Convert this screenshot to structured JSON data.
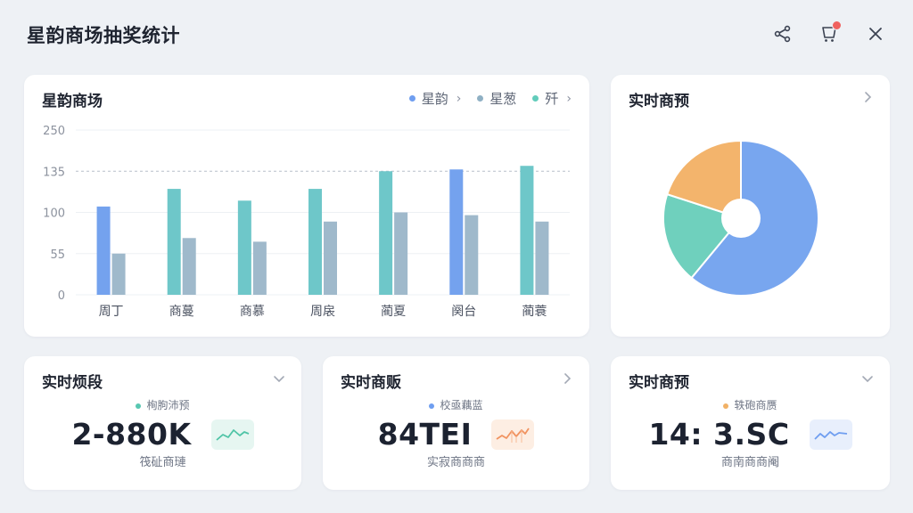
{
  "app": {
    "title": "星韵商场抽奖统计"
  },
  "bar_card": {
    "title": "星韵商场",
    "legend": [
      {
        "label": "星韵",
        "color": "#6f9ef0",
        "arrow": true
      },
      {
        "label": "星葱",
        "color": "#8fb0c4",
        "arrow": false
      },
      {
        "label": "歼",
        "color": "#62ccbb",
        "arrow": true
      }
    ]
  },
  "pie_card": {
    "title": "实时商预"
  },
  "metrics": [
    {
      "title": "实时烦段",
      "subtitle": "栒朐沛预",
      "dot_color": "#58c7b1",
      "value": "2-880K",
      "footer": "筏砋商璉",
      "spark_color": "#4fc4a6",
      "spark_bg": "#e6f6f1",
      "chevron": "down-icon"
    },
    {
      "title": "实时商贩",
      "subtitle": "校亟藕蓝",
      "dot_color": "#6f9ef0",
      "value": "84TEI",
      "footer": "实寂商商商",
      "spark_color": "#f19360",
      "spark_bg": "#fdeee3",
      "chevron": "right-icon"
    },
    {
      "title": "实时商预",
      "subtitle": "轶砲商赝",
      "dot_color": "#f1b166",
      "value": "14: 3.SC",
      "footer": "商南商商阉",
      "spark_color": "#6f9ef0",
      "spark_bg": "#e8effc",
      "chevron": "down-icon"
    }
  ],
  "chart_data": [
    {
      "type": "bar",
      "title": "星韵商场",
      "categories": [
        "周丁",
        "商蔓",
        "商慕",
        "周扆",
        "蔺夏",
        "阕台",
        "蔺蓑"
      ],
      "y_ticks": [
        0,
        55,
        100,
        135,
        250
      ],
      "reference_line": 135,
      "series": [
        {
          "name": "星韵",
          "color": "#74a2ee",
          "values": [
            105,
            0,
            0,
            0,
            0,
            140,
            0
          ]
        },
        {
          "name": "歼",
          "color": "#6ec7c9",
          "values": [
            0,
            120,
            110,
            120,
            135,
            0,
            150
          ]
        },
        {
          "name": "星葱",
          "color": "#9fb9cb",
          "values": [
            55,
            72,
            68,
            90,
            100,
            97,
            90
          ]
        }
      ],
      "grid": true
    },
    {
      "type": "pie",
      "title": "实时商预",
      "slices": [
        {
          "value": 61,
          "color": "#78a6ef"
        },
        {
          "value": 19,
          "color": "#6fd0bd"
        },
        {
          "value": 20,
          "color": "#f3b46c"
        }
      ],
      "donut_hole": true
    }
  ]
}
